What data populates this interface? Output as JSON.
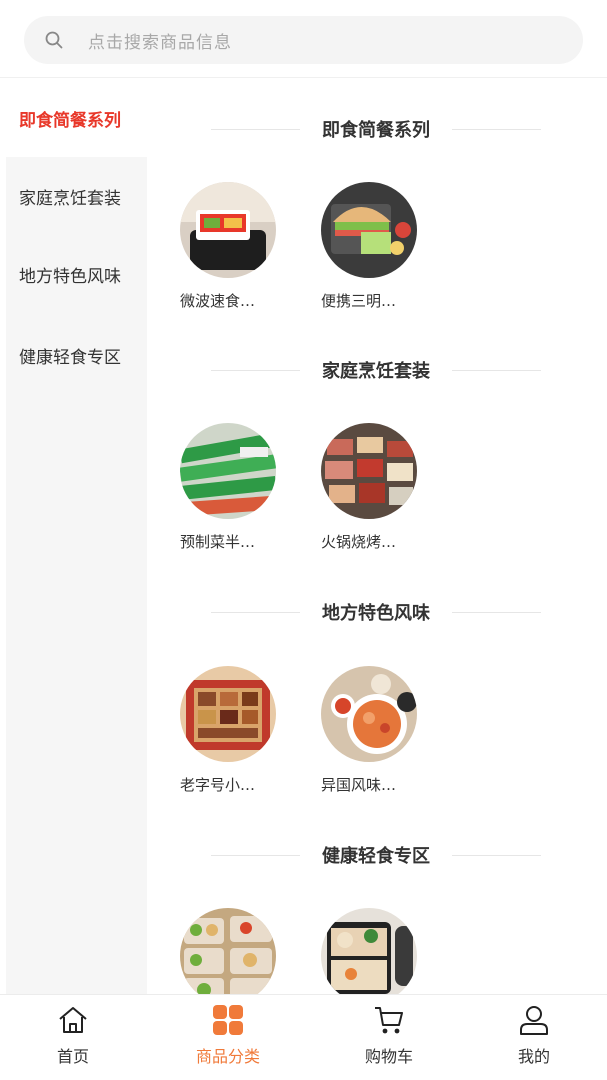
{
  "search": {
    "placeholder": "点击搜索商品信息",
    "icon": "search-icon"
  },
  "sidebar": {
    "items": [
      {
        "label": "即食简餐系列",
        "active": true
      },
      {
        "label": "家庭烹饪套装",
        "active": false
      },
      {
        "label": "地方特色风味",
        "active": false
      },
      {
        "label": "健康轻食专区",
        "active": false
      }
    ]
  },
  "sections": [
    {
      "title": "即食简餐系列",
      "products": [
        {
          "name": "微波速食…"
        },
        {
          "name": "便携三明…"
        }
      ]
    },
    {
      "title": "家庭烹饪套装",
      "products": [
        {
          "name": "预制菜半…"
        },
        {
          "name": "火锅烧烤…"
        }
      ]
    },
    {
      "title": "地方特色风味",
      "products": [
        {
          "name": "老字号小…"
        },
        {
          "name": "异国风味…"
        }
      ]
    },
    {
      "title": "健康轻食专区",
      "products": [
        {
          "name": ""
        },
        {
          "name": ""
        }
      ]
    }
  ],
  "tabbar": {
    "items": [
      {
        "label": "首页",
        "icon": "home-icon",
        "active": false
      },
      {
        "label": "商品分类",
        "icon": "category-icon",
        "active": true
      },
      {
        "label": "购物车",
        "icon": "cart-icon",
        "active": false
      },
      {
        "label": "我的",
        "icon": "user-icon",
        "active": false
      }
    ]
  },
  "colors": {
    "accent_red": "#e8382a",
    "accent_orange": "#f07a3a"
  }
}
